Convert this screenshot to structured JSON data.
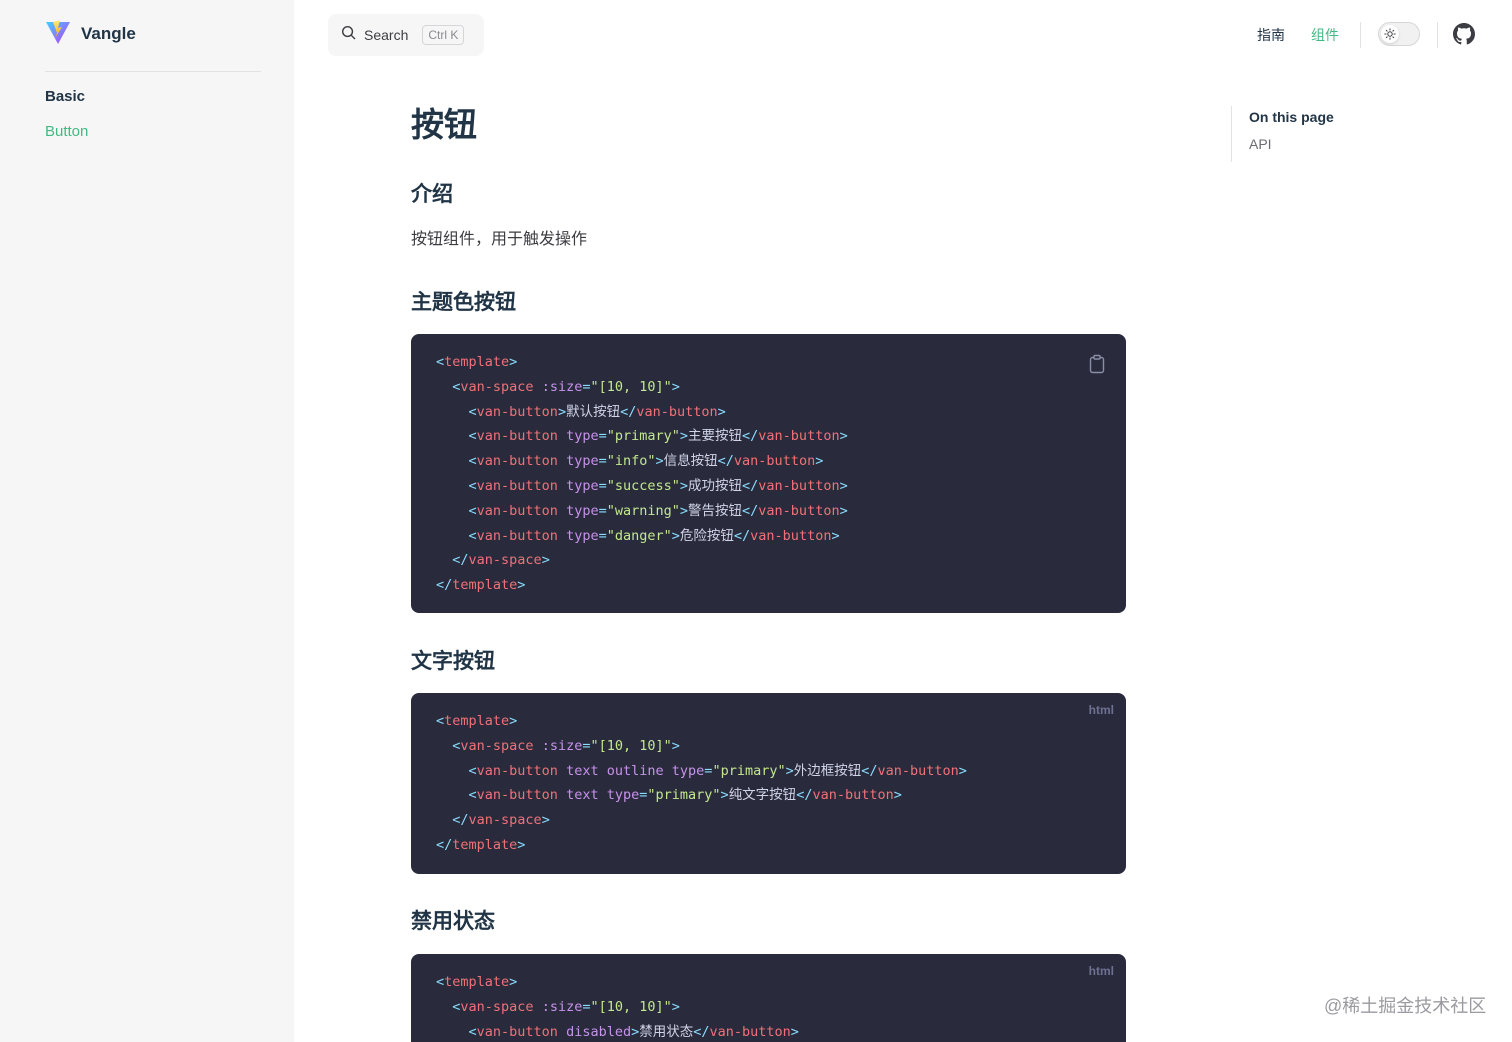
{
  "brand": {
    "title": "Vangle",
    "logo_icon": "vite-logo-icon"
  },
  "sidebar": {
    "group_title": "Basic",
    "items": [
      {
        "label": "Button",
        "active": true
      }
    ]
  },
  "navbar": {
    "search": {
      "label": "Search",
      "shortcut_ctrl": "Ctrl",
      "shortcut_key": "K",
      "icon": "search-icon"
    },
    "links": [
      {
        "label": "指南",
        "active": false
      },
      {
        "label": "组件",
        "active": true
      }
    ],
    "appearance_icon": "sun-icon",
    "social_icon": "github-icon"
  },
  "page": {
    "title": "按钮",
    "intro_heading": "介绍",
    "intro_text": "按钮组件，用于触发操作",
    "sections": [
      {
        "heading": "主题色按钮",
        "lang": "",
        "texts": [
          "默认按钮",
          "主要按钮",
          "信息按钮",
          "成功按钮",
          "警告按钮",
          "危险按钮"
        ]
      },
      {
        "heading": "文字按钮",
        "lang": "html",
        "texts": [
          "外边框按钮",
          "纯文字按钮"
        ]
      },
      {
        "heading": "禁用状态",
        "lang": "html",
        "texts": [
          "禁用状态"
        ]
      }
    ]
  },
  "aside": {
    "title": "On this page",
    "links": [
      "API"
    ]
  },
  "watermark": "@稀土掘金技术社区",
  "colors": {
    "accent": "#42b883",
    "code_bg": "#292b3c",
    "sidebar_bg": "#f6f6f7"
  }
}
